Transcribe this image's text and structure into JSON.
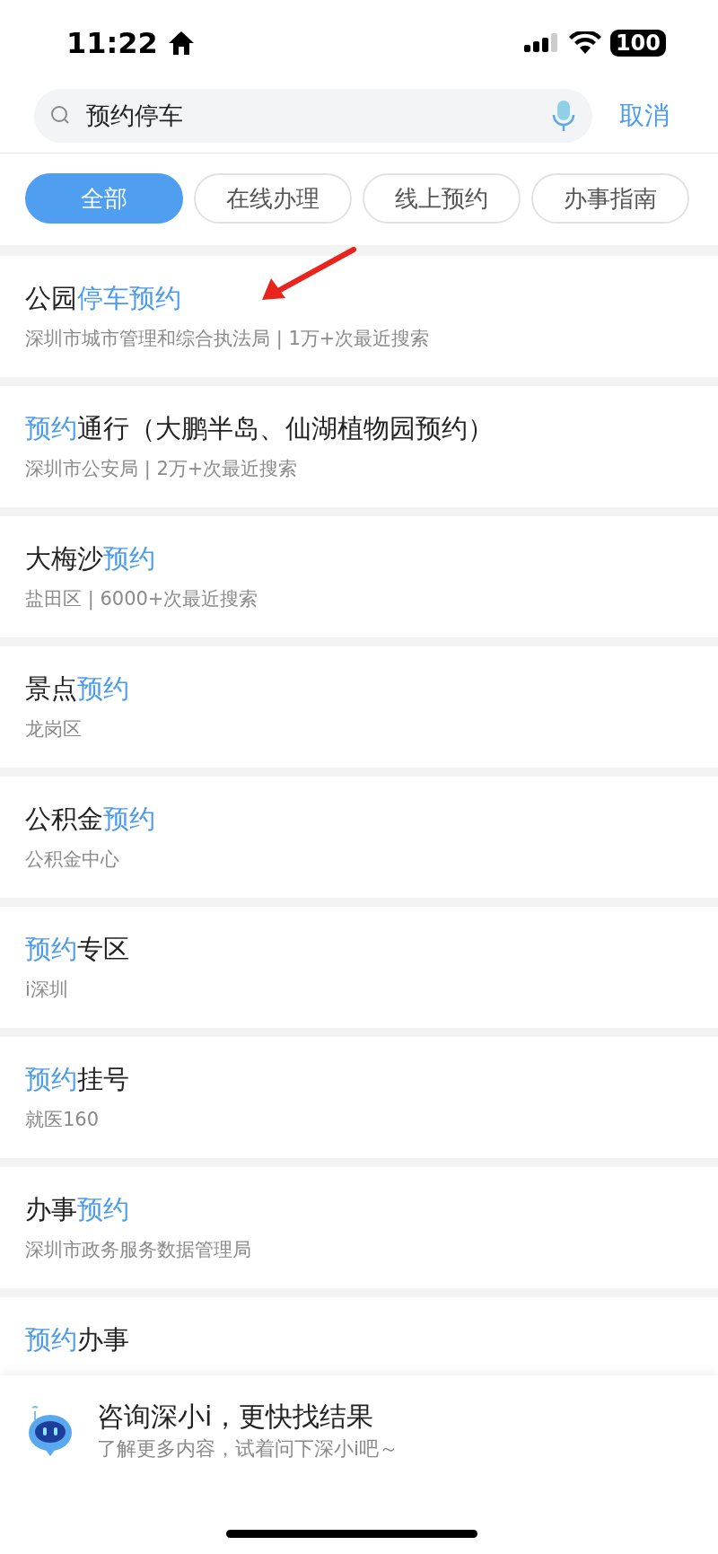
{
  "status_bar": {
    "time": "11:22",
    "battery": "100"
  },
  "search": {
    "value": "预约停车",
    "cancel": "取消"
  },
  "filters": [
    {
      "label": "全部",
      "selected": true
    },
    {
      "label": "在线办理",
      "selected": false
    },
    {
      "label": "线上预约",
      "selected": false
    },
    {
      "label": "办事指南",
      "selected": false
    }
  ],
  "results": [
    {
      "title": [
        {
          "text": "公园",
          "highlight": false
        },
        {
          "text": "停车预约",
          "highlight": true
        }
      ],
      "subtitle": "深圳市城市管理和综合执法局 | 1万+次最近搜索"
    },
    {
      "title": [
        {
          "text": "预约",
          "highlight": true
        },
        {
          "text": "通行（大鹏半岛、仙湖植物园预约）",
          "highlight": false
        }
      ],
      "subtitle": "深圳市公安局 | 2万+次最近搜索"
    },
    {
      "title": [
        {
          "text": "大梅沙",
          "highlight": false
        },
        {
          "text": "预约",
          "highlight": true
        }
      ],
      "subtitle": "盐田区 | 6000+次最近搜索"
    },
    {
      "title": [
        {
          "text": "景点",
          "highlight": false
        },
        {
          "text": "预约",
          "highlight": true
        }
      ],
      "subtitle": "龙岗区"
    },
    {
      "title": [
        {
          "text": "公积金",
          "highlight": false
        },
        {
          "text": "预约",
          "highlight": true
        }
      ],
      "subtitle": "公积金中心"
    },
    {
      "title": [
        {
          "text": "预约",
          "highlight": true
        },
        {
          "text": "专区",
          "highlight": false
        }
      ],
      "subtitle": "i深圳"
    },
    {
      "title": [
        {
          "text": "预约",
          "highlight": true
        },
        {
          "text": "挂号",
          "highlight": false
        }
      ],
      "subtitle": "就医160"
    },
    {
      "title": [
        {
          "text": "办事",
          "highlight": false
        },
        {
          "text": "预约",
          "highlight": true
        }
      ],
      "subtitle": "深圳市政务服务数据管理局"
    },
    {
      "title": [
        {
          "text": "预约",
          "highlight": true
        },
        {
          "text": "办事",
          "highlight": false
        }
      ]
    }
  ],
  "assistant": {
    "title": "咨询深小i，更快找结果",
    "subtitle": "了解更多内容，试着问下深小i吧～"
  }
}
